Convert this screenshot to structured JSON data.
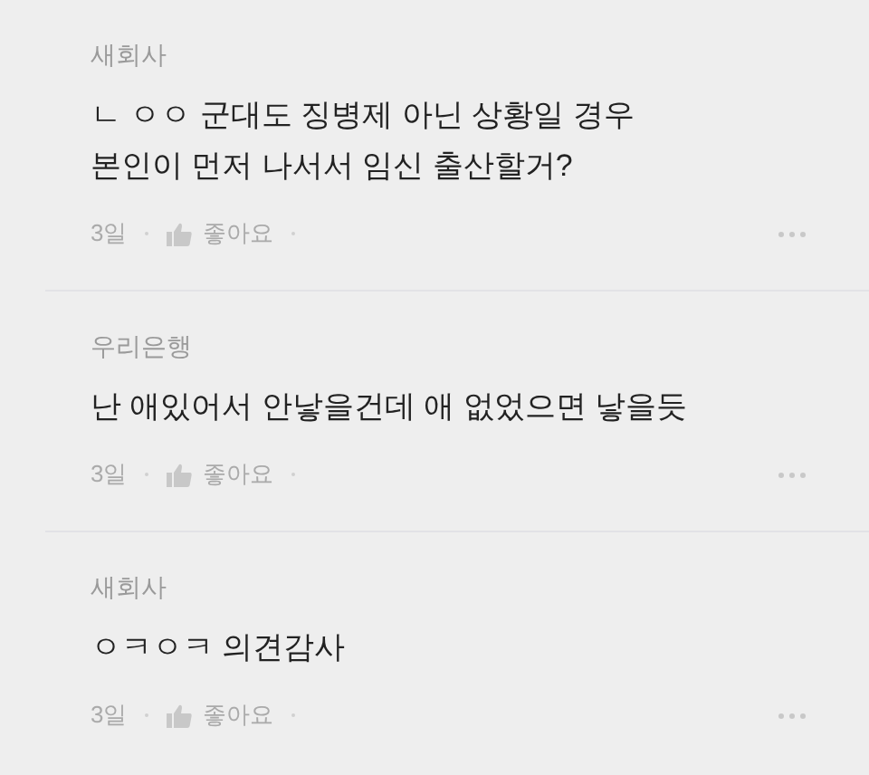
{
  "comments": [
    {
      "author": "새회사",
      "body": "ㄴ ㅇㅇ 군대도 징병제 아닌 상황일 경우\n본인이 먼저 나서서 임신 출산할거?",
      "time": "3일",
      "like": "좋아요"
    },
    {
      "author": "우리은행",
      "body": "난 애있어서 안낳을건데 애 없었으면 낳을듯",
      "time": "3일",
      "like": "좋아요"
    },
    {
      "author": "새회사",
      "body": "ㅇㅋㅇㅋ 의견감사",
      "time": "3일",
      "like": "좋아요"
    }
  ]
}
